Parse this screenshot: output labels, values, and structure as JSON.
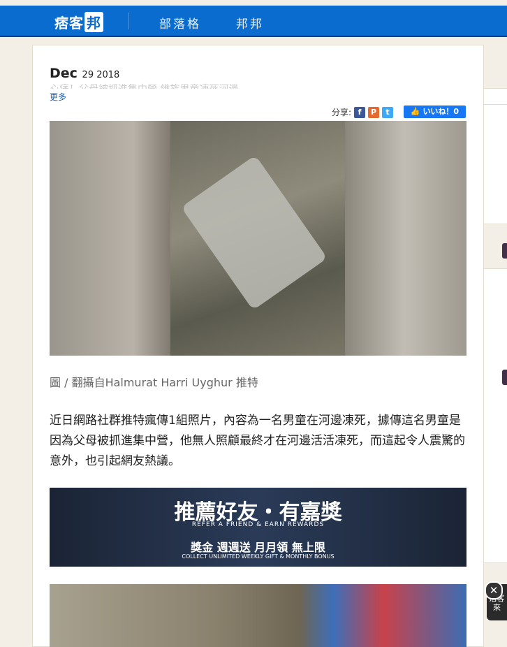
{
  "header": {
    "logo_text": "痞客",
    "logo_box": "邦",
    "nav": [
      "部落格",
      "邦邦"
    ]
  },
  "post": {
    "date_month": "Dec",
    "date_rest": "29 2018",
    "title_partial": "心痛！父母被抓進集中營 維族男童凍死河邊",
    "more": "更多",
    "share_label": "分享:",
    "like_label": "いいね！0",
    "caption": "圖 / 翻攝自Halmurat Harri Uyghur 推特",
    "body": "近日網路社群推特瘋傳1組照片，內容為一名男童在河邊凍死，據傳這名男童是因為父母被抓進集中營，他無人照顧最終才在河邊活活凍死，而這起令人震驚的意外，也引起網友熱議。"
  },
  "banner": {
    "headline": "推薦好友・有嘉獎",
    "headline_en": "REFER A FRIEND & EARN REWARDS",
    "sub": "獎金 週週送 月月領 無上限",
    "sub_en": "COLLECT UNLIMITED WEEKLY GIFT & MONTHLY BONUS"
  },
  "side_badge": {
    "text": "痞客\n來"
  },
  "close_label": "✕"
}
